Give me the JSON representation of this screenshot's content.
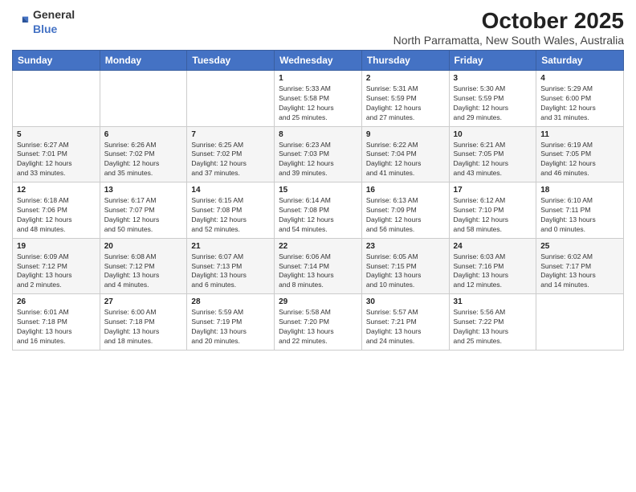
{
  "logo": {
    "general": "General",
    "blue": "Blue"
  },
  "title": "October 2025",
  "subtitle": "North Parramatta, New South Wales, Australia",
  "weekdays": [
    "Sunday",
    "Monday",
    "Tuesday",
    "Wednesday",
    "Thursday",
    "Friday",
    "Saturday"
  ],
  "weeks": [
    [
      {
        "day": "",
        "info": ""
      },
      {
        "day": "",
        "info": ""
      },
      {
        "day": "",
        "info": ""
      },
      {
        "day": "1",
        "info": "Sunrise: 5:33 AM\nSunset: 5:58 PM\nDaylight: 12 hours\nand 25 minutes."
      },
      {
        "day": "2",
        "info": "Sunrise: 5:31 AM\nSunset: 5:59 PM\nDaylight: 12 hours\nand 27 minutes."
      },
      {
        "day": "3",
        "info": "Sunrise: 5:30 AM\nSunset: 5:59 PM\nDaylight: 12 hours\nand 29 minutes."
      },
      {
        "day": "4",
        "info": "Sunrise: 5:29 AM\nSunset: 6:00 PM\nDaylight: 12 hours\nand 31 minutes."
      }
    ],
    [
      {
        "day": "5",
        "info": "Sunrise: 6:27 AM\nSunset: 7:01 PM\nDaylight: 12 hours\nand 33 minutes."
      },
      {
        "day": "6",
        "info": "Sunrise: 6:26 AM\nSunset: 7:02 PM\nDaylight: 12 hours\nand 35 minutes."
      },
      {
        "day": "7",
        "info": "Sunrise: 6:25 AM\nSunset: 7:02 PM\nDaylight: 12 hours\nand 37 minutes."
      },
      {
        "day": "8",
        "info": "Sunrise: 6:23 AM\nSunset: 7:03 PM\nDaylight: 12 hours\nand 39 minutes."
      },
      {
        "day": "9",
        "info": "Sunrise: 6:22 AM\nSunset: 7:04 PM\nDaylight: 12 hours\nand 41 minutes."
      },
      {
        "day": "10",
        "info": "Sunrise: 6:21 AM\nSunset: 7:05 PM\nDaylight: 12 hours\nand 43 minutes."
      },
      {
        "day": "11",
        "info": "Sunrise: 6:19 AM\nSunset: 7:05 PM\nDaylight: 12 hours\nand 46 minutes."
      }
    ],
    [
      {
        "day": "12",
        "info": "Sunrise: 6:18 AM\nSunset: 7:06 PM\nDaylight: 12 hours\nand 48 minutes."
      },
      {
        "day": "13",
        "info": "Sunrise: 6:17 AM\nSunset: 7:07 PM\nDaylight: 12 hours\nand 50 minutes."
      },
      {
        "day": "14",
        "info": "Sunrise: 6:15 AM\nSunset: 7:08 PM\nDaylight: 12 hours\nand 52 minutes."
      },
      {
        "day": "15",
        "info": "Sunrise: 6:14 AM\nSunset: 7:08 PM\nDaylight: 12 hours\nand 54 minutes."
      },
      {
        "day": "16",
        "info": "Sunrise: 6:13 AM\nSunset: 7:09 PM\nDaylight: 12 hours\nand 56 minutes."
      },
      {
        "day": "17",
        "info": "Sunrise: 6:12 AM\nSunset: 7:10 PM\nDaylight: 12 hours\nand 58 minutes."
      },
      {
        "day": "18",
        "info": "Sunrise: 6:10 AM\nSunset: 7:11 PM\nDaylight: 13 hours\nand 0 minutes."
      }
    ],
    [
      {
        "day": "19",
        "info": "Sunrise: 6:09 AM\nSunset: 7:12 PM\nDaylight: 13 hours\nand 2 minutes."
      },
      {
        "day": "20",
        "info": "Sunrise: 6:08 AM\nSunset: 7:12 PM\nDaylight: 13 hours\nand 4 minutes."
      },
      {
        "day": "21",
        "info": "Sunrise: 6:07 AM\nSunset: 7:13 PM\nDaylight: 13 hours\nand 6 minutes."
      },
      {
        "day": "22",
        "info": "Sunrise: 6:06 AM\nSunset: 7:14 PM\nDaylight: 13 hours\nand 8 minutes."
      },
      {
        "day": "23",
        "info": "Sunrise: 6:05 AM\nSunset: 7:15 PM\nDaylight: 13 hours\nand 10 minutes."
      },
      {
        "day": "24",
        "info": "Sunrise: 6:03 AM\nSunset: 7:16 PM\nDaylight: 13 hours\nand 12 minutes."
      },
      {
        "day": "25",
        "info": "Sunrise: 6:02 AM\nSunset: 7:17 PM\nDaylight: 13 hours\nand 14 minutes."
      }
    ],
    [
      {
        "day": "26",
        "info": "Sunrise: 6:01 AM\nSunset: 7:18 PM\nDaylight: 13 hours\nand 16 minutes."
      },
      {
        "day": "27",
        "info": "Sunrise: 6:00 AM\nSunset: 7:18 PM\nDaylight: 13 hours\nand 18 minutes."
      },
      {
        "day": "28",
        "info": "Sunrise: 5:59 AM\nSunset: 7:19 PM\nDaylight: 13 hours\nand 20 minutes."
      },
      {
        "day": "29",
        "info": "Sunrise: 5:58 AM\nSunset: 7:20 PM\nDaylight: 13 hours\nand 22 minutes."
      },
      {
        "day": "30",
        "info": "Sunrise: 5:57 AM\nSunset: 7:21 PM\nDaylight: 13 hours\nand 24 minutes."
      },
      {
        "day": "31",
        "info": "Sunrise: 5:56 AM\nSunset: 7:22 PM\nDaylight: 13 hours\nand 25 minutes."
      },
      {
        "day": "",
        "info": ""
      }
    ]
  ],
  "colors": {
    "header_bg": "#4472c4",
    "header_text": "#ffffff",
    "border": "#cccccc",
    "row_even": "#f5f5f5",
    "row_odd": "#ffffff"
  }
}
